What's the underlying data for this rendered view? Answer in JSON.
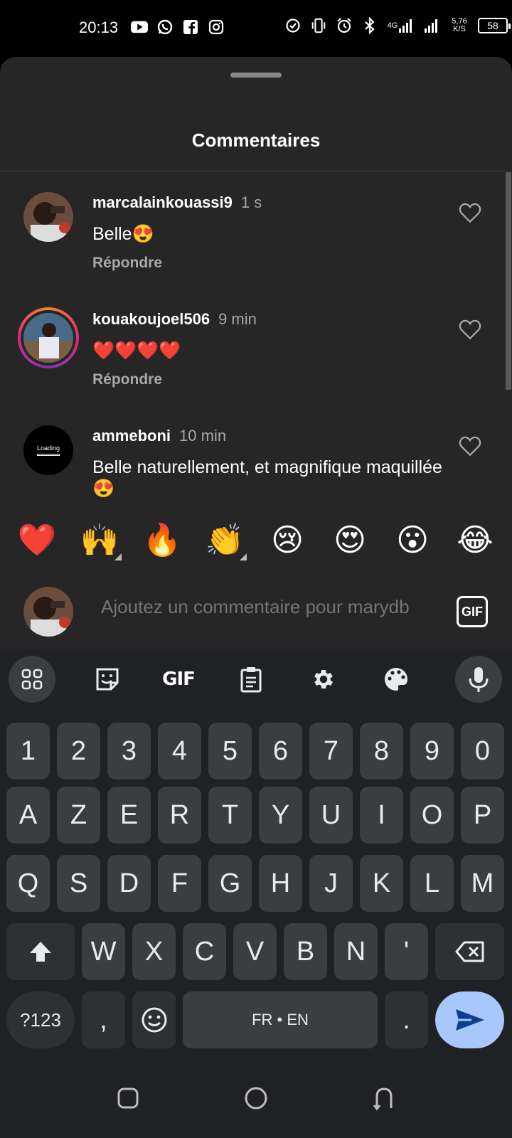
{
  "status_bar": {
    "time": "20:13",
    "network_label": "4G",
    "speed_value": "5,76",
    "speed_unit": "K/S",
    "battery": "58",
    "left_icons": [
      "youtube-icon",
      "whatsapp-icon",
      "facebook-icon",
      "instagram-icon"
    ],
    "right_icons": [
      "data-saver-icon",
      "vibrate-icon",
      "alarm-icon",
      "bluetooth-icon",
      "signal-icon",
      "signal-icon"
    ]
  },
  "sheet": {
    "title": "Commentaires"
  },
  "comments": [
    {
      "username": "marcalainkouassi9",
      "time": "1 s",
      "text": "Belle😍",
      "reply_label": "Répondre"
    },
    {
      "username": "kouakoujoel506",
      "time": "9 min",
      "text": "❤️❤️❤️❤️",
      "reply_label": "Répondre"
    },
    {
      "username": "ammeboni",
      "time": "10 min",
      "text": "Belle naturellement, et magnifique maquillée 😍",
      "avatar_text": "Loading"
    }
  ],
  "emoji_bar": [
    "❤️",
    "🙌",
    "🔥",
    "👏",
    "😢",
    "😍",
    "😮",
    "😂"
  ],
  "comment_input": {
    "placeholder": "Ajoutez un commentaire pour marydb",
    "gif_label": "GIF"
  },
  "keyboard": {
    "tools": [
      "apps-icon",
      "sticker-icon",
      "gif-icon",
      "clipboard-icon",
      "settings-icon",
      "palette-icon",
      "microphone-icon"
    ],
    "gif_tool_label": "GIF",
    "rows": {
      "numbers": [
        "1",
        "2",
        "3",
        "4",
        "5",
        "6",
        "7",
        "8",
        "9",
        "0"
      ],
      "row1": [
        "A",
        "Z",
        "E",
        "R",
        "T",
        "Y",
        "U",
        "I",
        "O",
        "P"
      ],
      "row2": [
        "Q",
        "S",
        "D",
        "F",
        "G",
        "H",
        "J",
        "K",
        "L",
        "M"
      ],
      "row3": [
        "W",
        "X",
        "C",
        "V",
        "B",
        "N",
        "'"
      ]
    },
    "symbols_label": "?123",
    "comma_label": ",",
    "space_label": "FR • EN",
    "period_label": "."
  },
  "colors": {
    "sheet_bg": "#262626",
    "keyboard_bg": "#202124",
    "key_bg": "#3c3d40",
    "send_key_bg": "#a8c7fa",
    "heart_red": "#e41e3f"
  }
}
